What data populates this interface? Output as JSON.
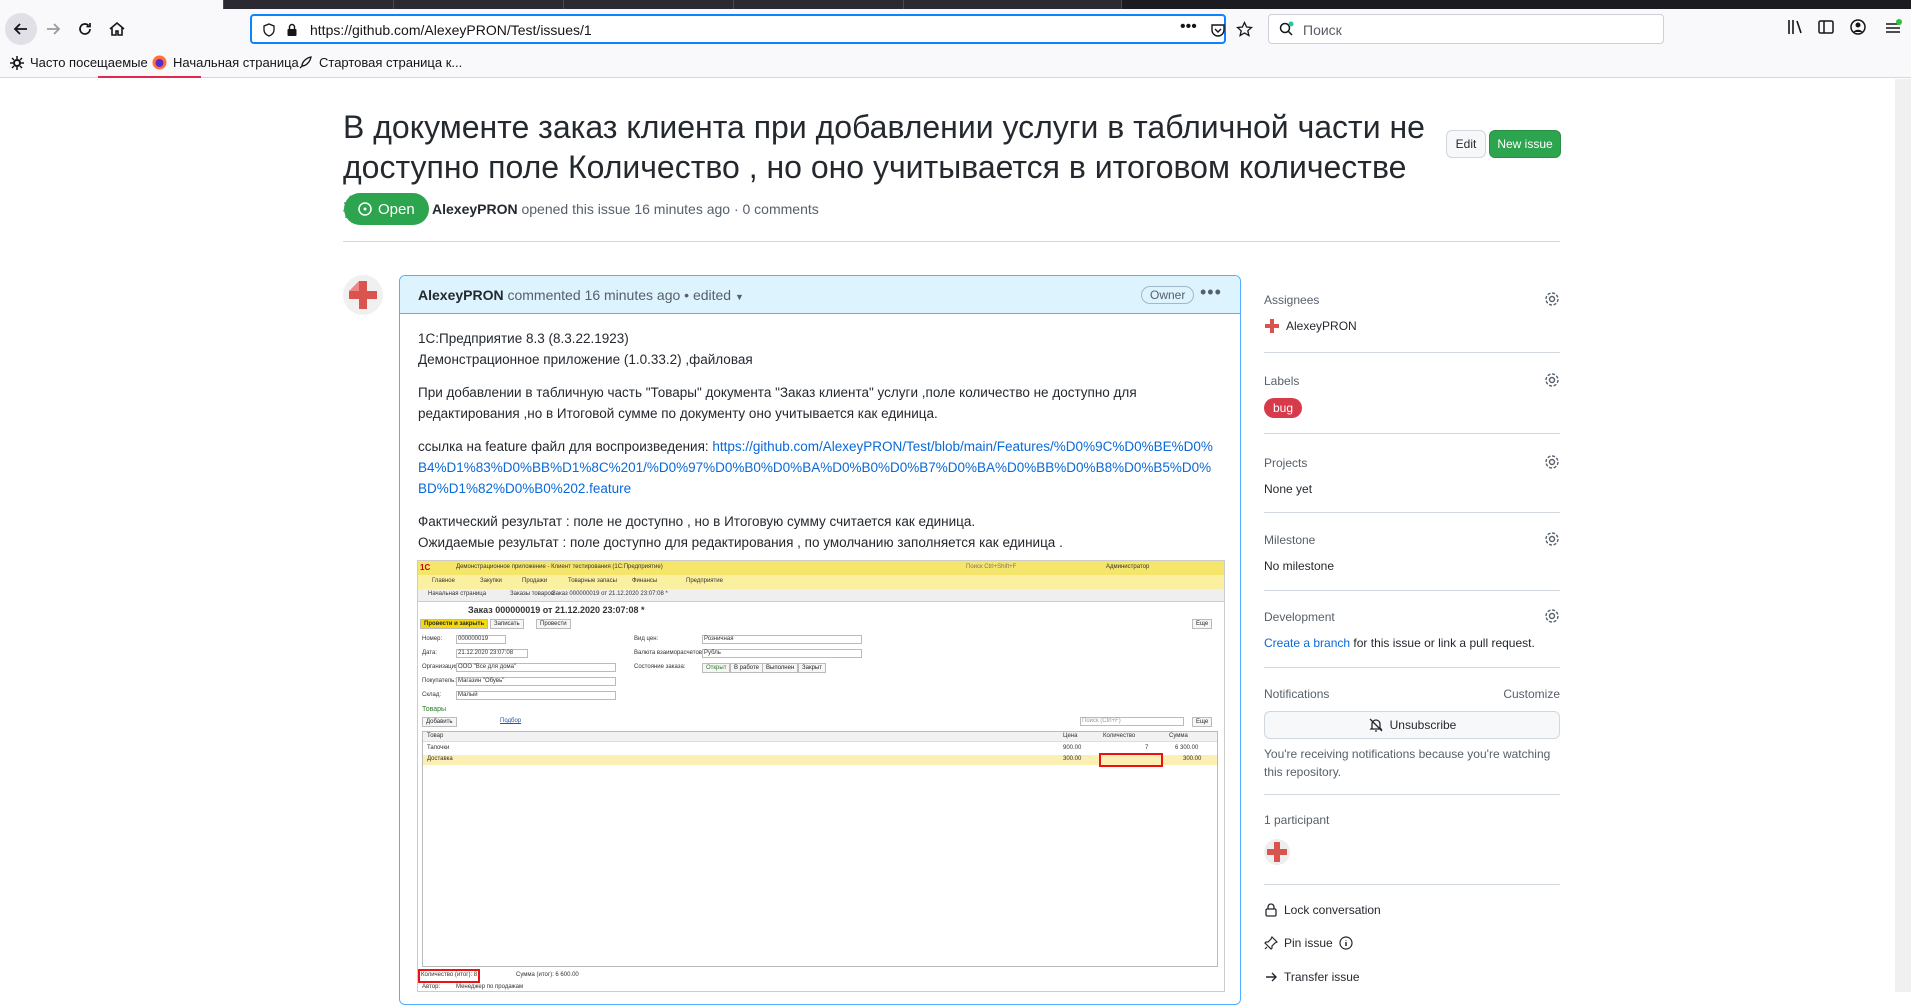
{
  "browser": {
    "url": "https://github.com/AlexeyPRON/Test/issues/1",
    "search_placeholder": "Поиск",
    "more_icon": "•••",
    "bookmarks": [
      {
        "label": "Часто посещаемые",
        "icon": "gear-icon"
      },
      {
        "label": "Начальная страница",
        "icon": "firefox-icon"
      },
      {
        "label": "Стартовая страница к...",
        "icon": "rocket-icon"
      }
    ]
  },
  "issue": {
    "title": "В документе заказ клиента при добавлении услуги в табличной части не доступно поле Количество , но оно учитывается в итоговом количестве",
    "number": "#1",
    "edit_label": "Edit",
    "new_issue_label": "New issue",
    "state_label": "Open",
    "author": "AlexeyPRON",
    "meta_text": "opened this issue 16 minutes ago · 0 comments"
  },
  "comment": {
    "author": "AlexeyPRON",
    "action": "commented",
    "time": "16 minutes ago",
    "edited": "• edited",
    "owner_badge": "Owner",
    "body_line1": "1С:Предприятие 8.3 (8.3.22.1923)",
    "body_line2": "Демонстрационное приложение (1.0.33.2) ,файловая",
    "body_para2": "При добавлении в табличную часть \"Товары\" документа \"Заказ клиента\" услуги ,поле количество не доступно для редактирования ,но в Итоговой сумме по документу оно учитывается как единица.",
    "link_prefix": "ссылка на feature файл для воспроизведения: ",
    "link_url": "https://github.com/AlexeyPRON/Test/blob/main/Features/%D0%9C%D0%BE%D0%B4%D1%83%D0%BB%D1%8C%201/%D0%97%D0%B0%D0%BA%D0%B0%D0%B7%D0%BA%D0%BB%D0%B8%D0%B5%D0%BD%D1%82%D0%B0%202.feature",
    "link_display": "https://github.com/AlexeyPRON/Test/blob/main/Features/%D0%9C%D0%BE%D0%B4%D1%83%D0%BB%D1%8C%201/%D0%97%D0%B0%D0%BA%D0%B0%D0%B7%D0%BA%D0%BB%D0%B8%D0%B5%D0%BD%D1%82%D0%B0%202.feature",
    "actual": "Фактический результат : поле не доступно , но в Итоговую сумму считается как единица.",
    "expected": "Ожидаемые результат : поле доступно для редактирования , по умолчанию заполняется как единица ."
  },
  "screenshot": {
    "window_title": "Демонстрационное приложение - Клиент тестирования (1С:Предприятие)",
    "search_box": "Поиск Ctrl+Shift+F",
    "user": "Администратор",
    "sections": [
      "Главное",
      "Закупки",
      "Продажи",
      "Товарные запасы",
      "Финансы",
      "Предприятие"
    ],
    "tabs": [
      "Начальная страница",
      "Заказы товаров",
      "Заказ 000000019 от 21.12.2020 23:07:08 *"
    ],
    "doc_title": "Заказ 000000019 от 21.12.2020 23:07:08 *",
    "buttons": [
      "Провести и закрыть",
      "Записать",
      "Провести"
    ],
    "more": "Еще",
    "fields_left": [
      {
        "label": "Номер:",
        "value": "000000019"
      },
      {
        "label": "Дата:",
        "value": "21.12.2020 23:07:08"
      },
      {
        "label": "Организация:",
        "value": "ООО \"Все для дома\""
      },
      {
        "label": "Покупатель:",
        "value": "Магазин \"Обувь\""
      },
      {
        "label": "Склад:",
        "value": "Малый"
      }
    ],
    "fields_right": [
      {
        "label": "Вид цен:",
        "value": "Розничная"
      },
      {
        "label": "Валюта взаиморасчетов:",
        "value": "Рубль"
      },
      {
        "label": "Состояние заказа:",
        "value": ""
      }
    ],
    "states": [
      "Открыт",
      "В работе",
      "Выполнен",
      "Закрыт"
    ],
    "goods_label": "Товары",
    "add_label": "Добавить",
    "pick_label": "Подбор",
    "search_ctrl": "Поиск (Ctrl+F)",
    "columns": [
      "Товар",
      "Цена",
      "Количество",
      "Сумма"
    ],
    "rows": [
      {
        "name": "Тапочки",
        "price": "900.00",
        "qty": "7",
        "sum": "6 300.00"
      },
      {
        "name": "Доставка",
        "price": "300.00",
        "qty": "",
        "sum": "300.00"
      }
    ],
    "total_qty": "Количество (итог): 8",
    "total_sum": "Сумма (итог): 6 600.00",
    "author_label": "Автор:",
    "author_value": "Менеджер по продажам"
  },
  "sidebar": {
    "assignees_title": "Assignees",
    "assignee": "AlexeyPRON",
    "labels_title": "Labels",
    "label_bug": "bug",
    "projects_title": "Projects",
    "projects_value": "None yet",
    "milestone_title": "Milestone",
    "milestone_value": "No milestone",
    "development_title": "Development",
    "create_branch": "Create a branch",
    "development_text": " for this issue or link a pull request.",
    "notifications_title": "Notifications",
    "customize": "Customize",
    "unsubscribe": "Unsubscribe",
    "notif_reason": "You're receiving notifications because you're watching this repository.",
    "participants": "1 participant",
    "lock": "Lock conversation",
    "pin": "Pin issue",
    "transfer": "Transfer issue"
  },
  "colors": {
    "accent": "#0969da",
    "green": "#2da44e",
    "bug": "#d73a4a",
    "highlight": "#ddf4ff"
  }
}
